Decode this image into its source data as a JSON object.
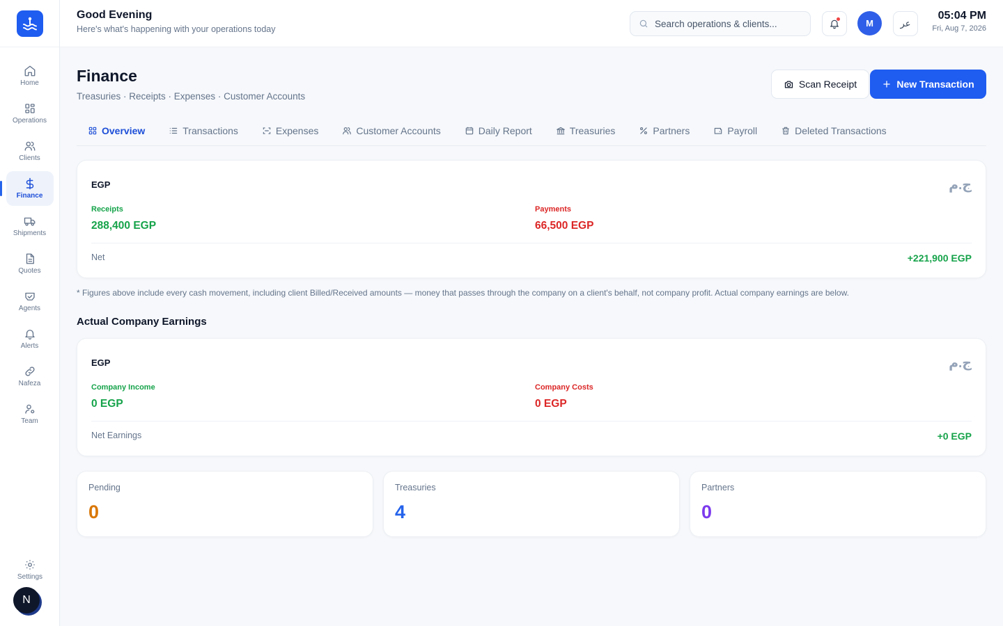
{
  "sidebar": {
    "items": [
      {
        "label": "Home",
        "icon": "home-icon"
      },
      {
        "label": "Operations",
        "icon": "grid-icon"
      },
      {
        "label": "Clients",
        "icon": "users-icon"
      },
      {
        "label": "Finance",
        "icon": "dollar-icon",
        "active": true
      },
      {
        "label": "Shipments",
        "icon": "truck-icon"
      },
      {
        "label": "Quotes",
        "icon": "document-icon"
      },
      {
        "label": "Agents",
        "icon": "handshake-icon"
      },
      {
        "label": "Alerts",
        "icon": "bell-icon"
      },
      {
        "label": "Nafeza",
        "icon": "link-icon"
      },
      {
        "label": "Team",
        "icon": "team-icon"
      }
    ],
    "settings_label": "Settings",
    "badge_letter": "N"
  },
  "header": {
    "greeting": "Good Evening",
    "subtitle": "Here's what's happening with your operations today",
    "search_placeholder": "Search operations & clients...",
    "avatar_initial": "M",
    "lang_toggle": "عر",
    "time": "05:04 PM",
    "date": "Fri, Aug 7, 2026"
  },
  "page": {
    "title": "Finance",
    "subtitle": "Treasuries · Receipts · Expenses · Customer Accounts",
    "scan_label": "Scan Receipt",
    "new_label": "New Transaction"
  },
  "tabs": [
    {
      "label": "Overview",
      "icon": "overview-icon",
      "active": true
    },
    {
      "label": "Transactions",
      "icon": "list-icon"
    },
    {
      "label": "Expenses",
      "icon": "scan-icon"
    },
    {
      "label": "Customer Accounts",
      "icon": "users-icon"
    },
    {
      "label": "Daily Report",
      "icon": "calendar-icon"
    },
    {
      "label": "Treasuries",
      "icon": "bank-icon"
    },
    {
      "label": "Partners",
      "icon": "percent-icon"
    },
    {
      "label": "Payroll",
      "icon": "wallet-icon"
    },
    {
      "label": "Deleted Transactions",
      "icon": "trash-icon"
    }
  ],
  "cash_card": {
    "currency": "EGP",
    "currency_ar": "ج.م",
    "receipts_label": "Receipts",
    "receipts_value": "288,400 EGP",
    "payments_label": "Payments",
    "payments_value": "66,500 EGP",
    "net_label": "Net",
    "net_value": "+221,900 EGP"
  },
  "note": "* Figures above include every cash movement, including client Billed/Received amounts — money that passes through the company on a client's behalf, not company profit. Actual company earnings are below.",
  "earnings": {
    "section_title": "Actual Company Earnings",
    "currency": "EGP",
    "currency_ar": "ج.م",
    "income_label": "Company Income",
    "income_value": "0 EGP",
    "costs_label": "Company Costs",
    "costs_value": "0 EGP",
    "net_label": "Net Earnings",
    "net_value": "+0 EGP"
  },
  "stats": [
    {
      "label": "Pending",
      "value": "0",
      "color": "#d97706"
    },
    {
      "label": "Treasuries",
      "value": "4",
      "color": "#2563eb"
    },
    {
      "label": "Partners",
      "value": "0",
      "color": "#7c3aed"
    }
  ],
  "colors": {
    "primary": "#1f5cf0",
    "positive": "#16a34a",
    "negative": "#dc2626"
  }
}
